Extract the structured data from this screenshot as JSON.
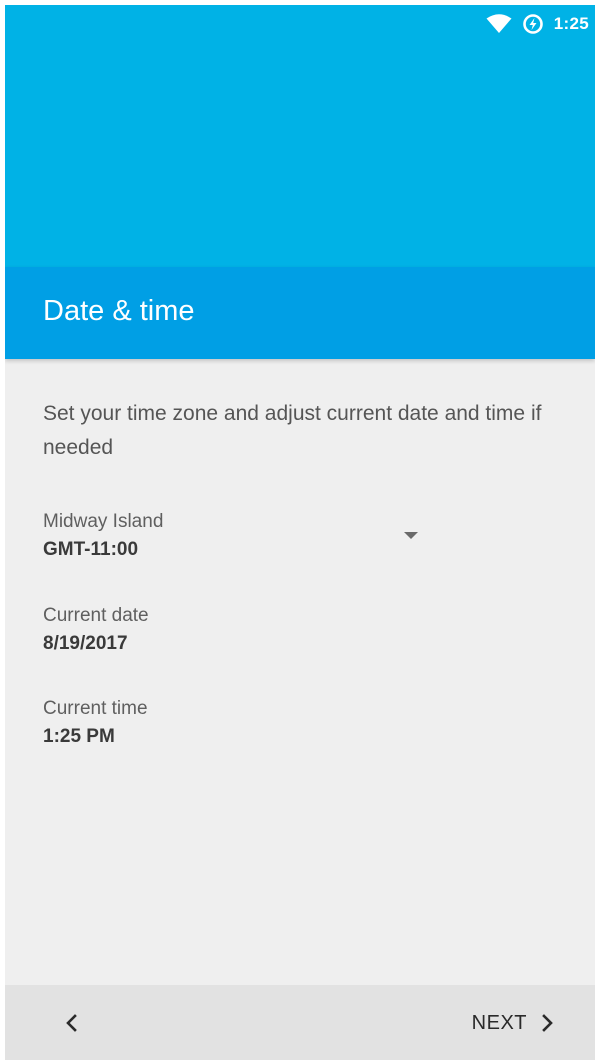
{
  "status_bar": {
    "time": "1:25",
    "icons": [
      "wifi-icon",
      "data-saver-icon"
    ]
  },
  "header": {
    "title": "Date & time"
  },
  "description": "Set your time zone and adjust current date and time if needed",
  "timezone": {
    "name": "Midway Island",
    "offset": "GMT-11:00"
  },
  "date": {
    "label": "Current date",
    "value": "8/19/2017"
  },
  "time": {
    "label": "Current time",
    "value": "1:25 PM"
  },
  "navigation": {
    "back_icon": "chevron-left-icon",
    "next_label": "NEXT",
    "next_icon": "chevron-right-icon"
  },
  "colors": {
    "hero": "#00b2e6",
    "title_bar": "#009fe5",
    "background": "#efefef",
    "bottom_bar": "#e2e2e2"
  }
}
